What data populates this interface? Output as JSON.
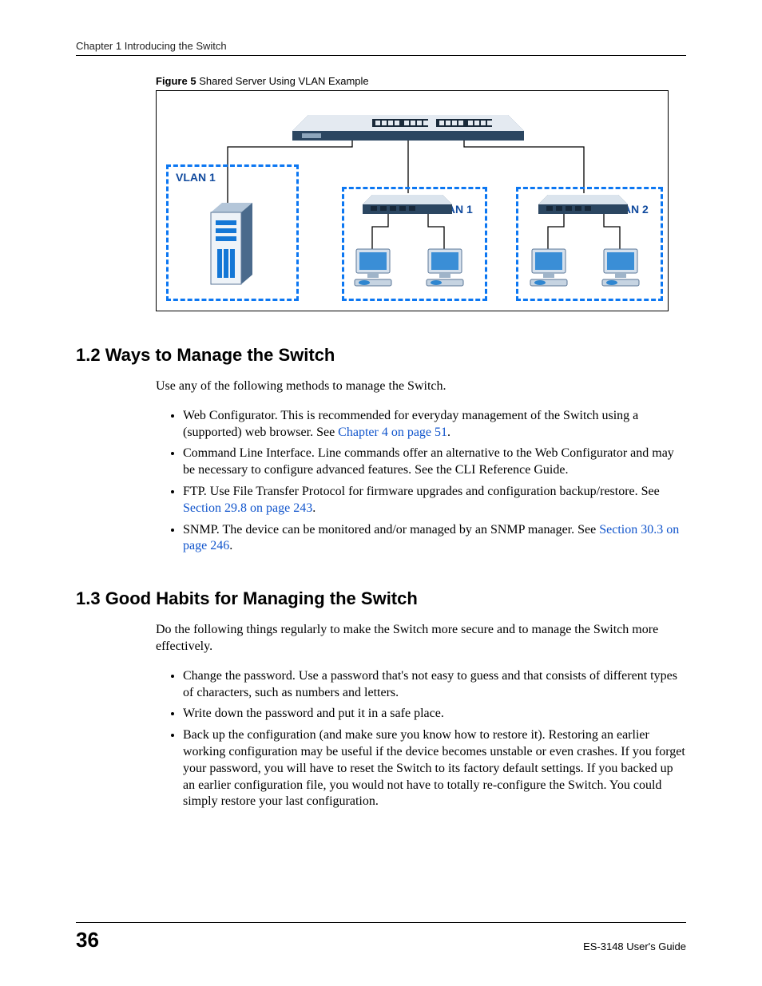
{
  "header": "Chapter 1 Introducing the Switch",
  "figure": {
    "label_bold": "Figure 5",
    "label_rest": "   Shared Server Using VLAN Example",
    "vlan1a": "VLAN 1",
    "vlan1b": "VLAN 1",
    "vlan2": "VLAN 2"
  },
  "sec12": {
    "title": "1.2  Ways to Manage the Switch",
    "intro": "Use any of the following methods to manage the Switch.",
    "b1a": "Web Configurator. This is recommended for everyday management of the Switch using a (supported) web browser. See ",
    "b1link": "Chapter 4 on page 51",
    "b1b": ".",
    "b2": "Command Line Interface. Line commands offer an alternative to the Web Configurator and may be necessary to configure advanced features. See the CLI Reference Guide.",
    "b3a": "FTP. Use File Transfer Protocol for firmware upgrades and configuration backup/restore. See ",
    "b3link": "Section 29.8 on page 243",
    "b3b": ".",
    "b4a": "SNMP. The device can be monitored and/or managed by an SNMP manager. See ",
    "b4link": "Section 30.3 on page 246",
    "b4b": "."
  },
  "sec13": {
    "title": "1.3  Good Habits for Managing the Switch",
    "intro": "Do the following things regularly to make the Switch more secure and to manage the Switch more effectively.",
    "b1": "Change the password. Use a password that's not easy to guess and that consists of different types of characters, such as numbers and letters.",
    "b2": "Write down the password and put it in a safe place.",
    "b3": "Back up the configuration (and make sure you know how to restore it). Restoring an earlier working configuration may be useful if the device becomes unstable or even crashes. If you forget your password, you will have to reset the Switch to its factory default settings. If you backed up an earlier configuration file, you would not have to totally re-configure the Switch. You could simply restore your last configuration."
  },
  "footer": {
    "page": "36",
    "guide": "ES-3148 User's Guide"
  }
}
